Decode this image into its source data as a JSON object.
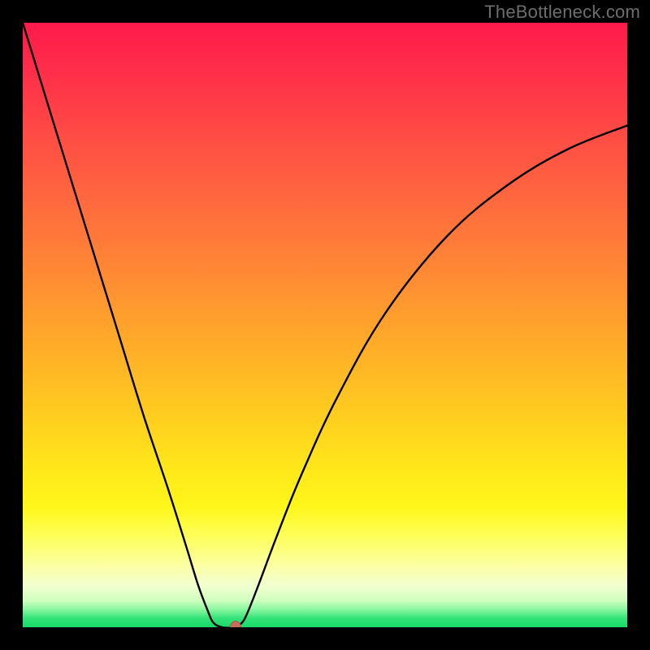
{
  "watermark": "TheBottleneck.com",
  "chart_data": {
    "type": "line",
    "title": "",
    "xlabel": "",
    "ylabel": "",
    "xlim": [
      0,
      100
    ],
    "ylim": [
      0,
      100
    ],
    "grid": false,
    "legend": false,
    "background": {
      "kind": "vertical-gradient",
      "stops": [
        {
          "pos": 0.0,
          "color": "#ff1a4b"
        },
        {
          "pos": 0.3,
          "color": "#ff6a3e"
        },
        {
          "pos": 0.55,
          "color": "#ffae28"
        },
        {
          "pos": 0.78,
          "color": "#fff61a"
        },
        {
          "pos": 0.92,
          "color": "#f3ffcf"
        },
        {
          "pos": 1.0,
          "color": "#17d968"
        }
      ]
    },
    "series": [
      {
        "name": "bottleneck-curve",
        "color": "#000000",
        "x": [
          0.0,
          4.0,
          8.0,
          12.0,
          16.0,
          20.0,
          24.0,
          27.0,
          29.0,
          30.5,
          31.5,
          33.0,
          35.0,
          36.0,
          37.0,
          39.0,
          42.0,
          46.0,
          52.0,
          60.0,
          70.0,
          80.0,
          90.0,
          100.0
        ],
        "y": [
          100.0,
          87.0,
          74.0,
          61.0,
          48.0,
          35.0,
          23.0,
          13.5,
          7.0,
          3.0,
          0.8,
          0.0,
          0.0,
          0.5,
          2.0,
          7.0,
          15.0,
          25.0,
          38.0,
          52.0,
          64.5,
          73.0,
          79.0,
          83.0
        ]
      }
    ],
    "markers": [
      {
        "name": "minimum-point",
        "x": 35.2,
        "y": 0.0,
        "color": "#c96a5e"
      }
    ]
  }
}
